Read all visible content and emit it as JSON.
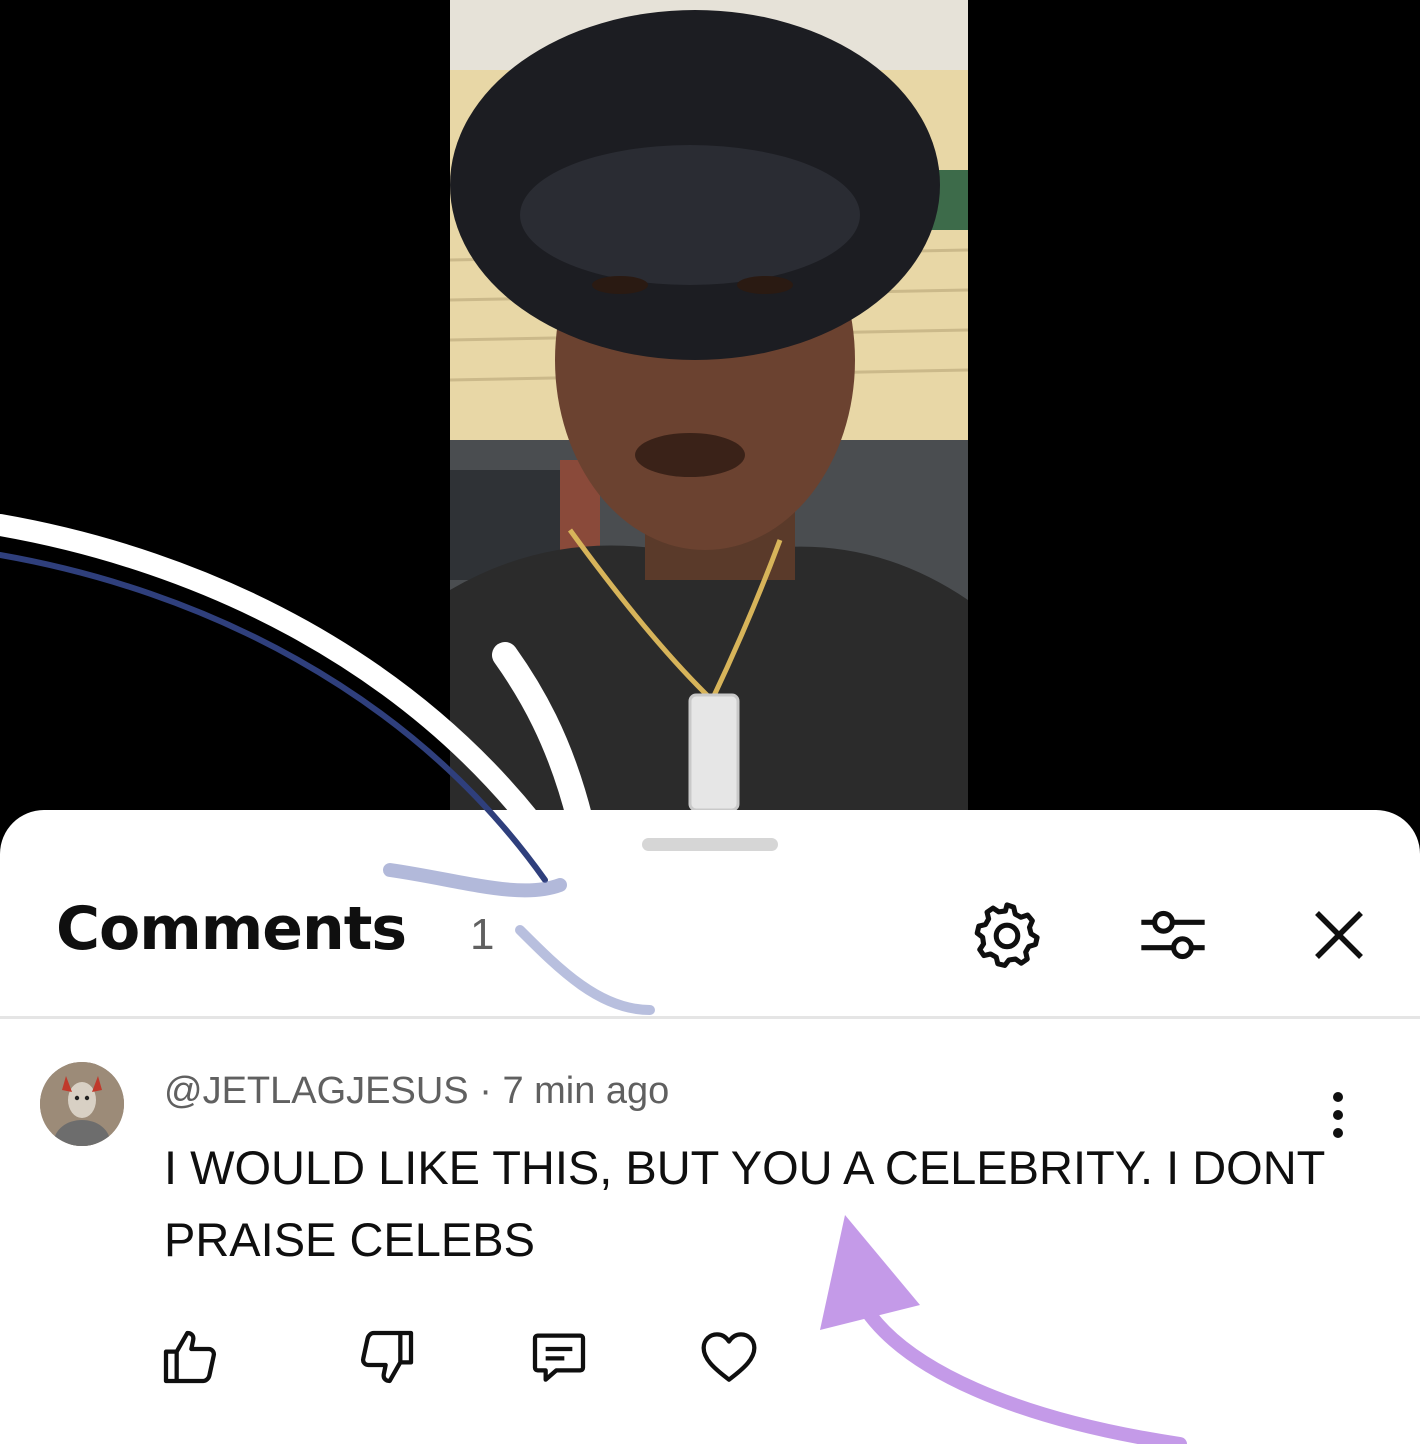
{
  "video": {
    "description_icon": "video-frame"
  },
  "comments_panel": {
    "title": "Comments",
    "count": "1",
    "icons": {
      "settings": "gear-icon",
      "filter": "sliders-icon",
      "close": "close-icon"
    }
  },
  "comments": [
    {
      "author": "@JETLAGJESUS",
      "separator": " · ",
      "time": "7 min ago",
      "text": "I WOULD LIKE THIS, BUT YOU A CELEBRITY. I DONT PRAISE CELEBS",
      "actions": {
        "like": "thumbs-up-icon",
        "dislike": "thumbs-down-icon",
        "reply": "reply-icon",
        "heart": "heart-icon"
      }
    }
  ],
  "colors": {
    "sheet_bg": "#ffffff",
    "text_primary": "#0f0f0f",
    "text_secondary": "#606060",
    "annotation_blue": "#3a4a8a",
    "annotation_purple": "#c49ae8"
  }
}
